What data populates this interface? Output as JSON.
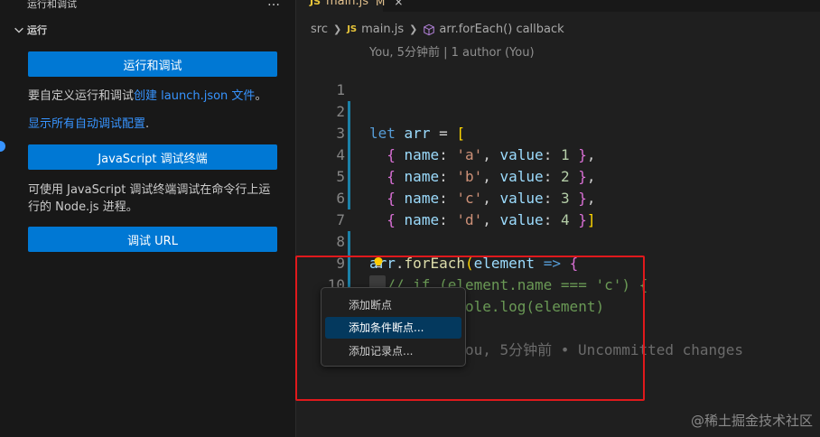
{
  "sidebar": {
    "title": "运行和调试",
    "more_icon": "…",
    "section_title": "运行",
    "run_button": "运行和调试",
    "custom_text": "要自定义运行和调试",
    "custom_link": "创建 launch.json 文件",
    "custom_suffix": "。",
    "show_all_link": "显示所有自动调试配置",
    "show_all_suffix": ".",
    "js_terminal_button": "JavaScript 调试终端",
    "js_terminal_desc": "可使用 JavaScript 调试终端调试在命令行上运行的 Node.js 进程。",
    "debug_url_button": "调试 URL"
  },
  "editor": {
    "tab": {
      "icon": "JS",
      "name": "main.js",
      "status": "M",
      "close": "×"
    },
    "breadcrumb": {
      "folder": "src",
      "file_icon": "JS",
      "file": "main.js",
      "symbol": "arr.forEach() callback"
    },
    "blame_header": "You, 5分钟前 | 1 author (You)",
    "lines": [
      {
        "n": "1"
      },
      {
        "n": "2"
      },
      {
        "n": "3"
      },
      {
        "n": "4"
      },
      {
        "n": "5"
      },
      {
        "n": "6"
      },
      {
        "n": "7"
      },
      {
        "n": "8"
      },
      {
        "n": "9"
      },
      {
        "n": "10"
      },
      {
        "n": "11"
      }
    ],
    "code": {
      "l1_kw": "let",
      "l1_var": "arr",
      "l1_op": " = ",
      "l1_br": "[",
      "l2": {
        "name": "'a'",
        "value": "1"
      },
      "l3": {
        "name": "'b'",
        "value": "2"
      },
      "l4": {
        "name": "'c'",
        "value": "3"
      },
      "l5": {
        "name": "'d'",
        "value": "4"
      },
      "k_name": "name",
      "k_value": "value",
      "l7_var": "arr",
      "l7_fn": "forEach",
      "l7_param": "element",
      "l7_arrow": " => ",
      "l8": "// if (element.name === 'c') {",
      "l9": "//   console.log(element)",
      "l10": "// }",
      "l11_blame": "You, 5分钟前 • Uncommitted changes"
    }
  },
  "context_menu": {
    "items": [
      "添加断点",
      "添加条件断点...",
      "添加记录点..."
    ],
    "selected_index": 1
  },
  "watermark": "@稀土掘金技术社区",
  "colors": {
    "accent": "#0078d4",
    "link": "#3794ff",
    "highlight": "#e0191c",
    "menu_selected": "#04395e"
  }
}
